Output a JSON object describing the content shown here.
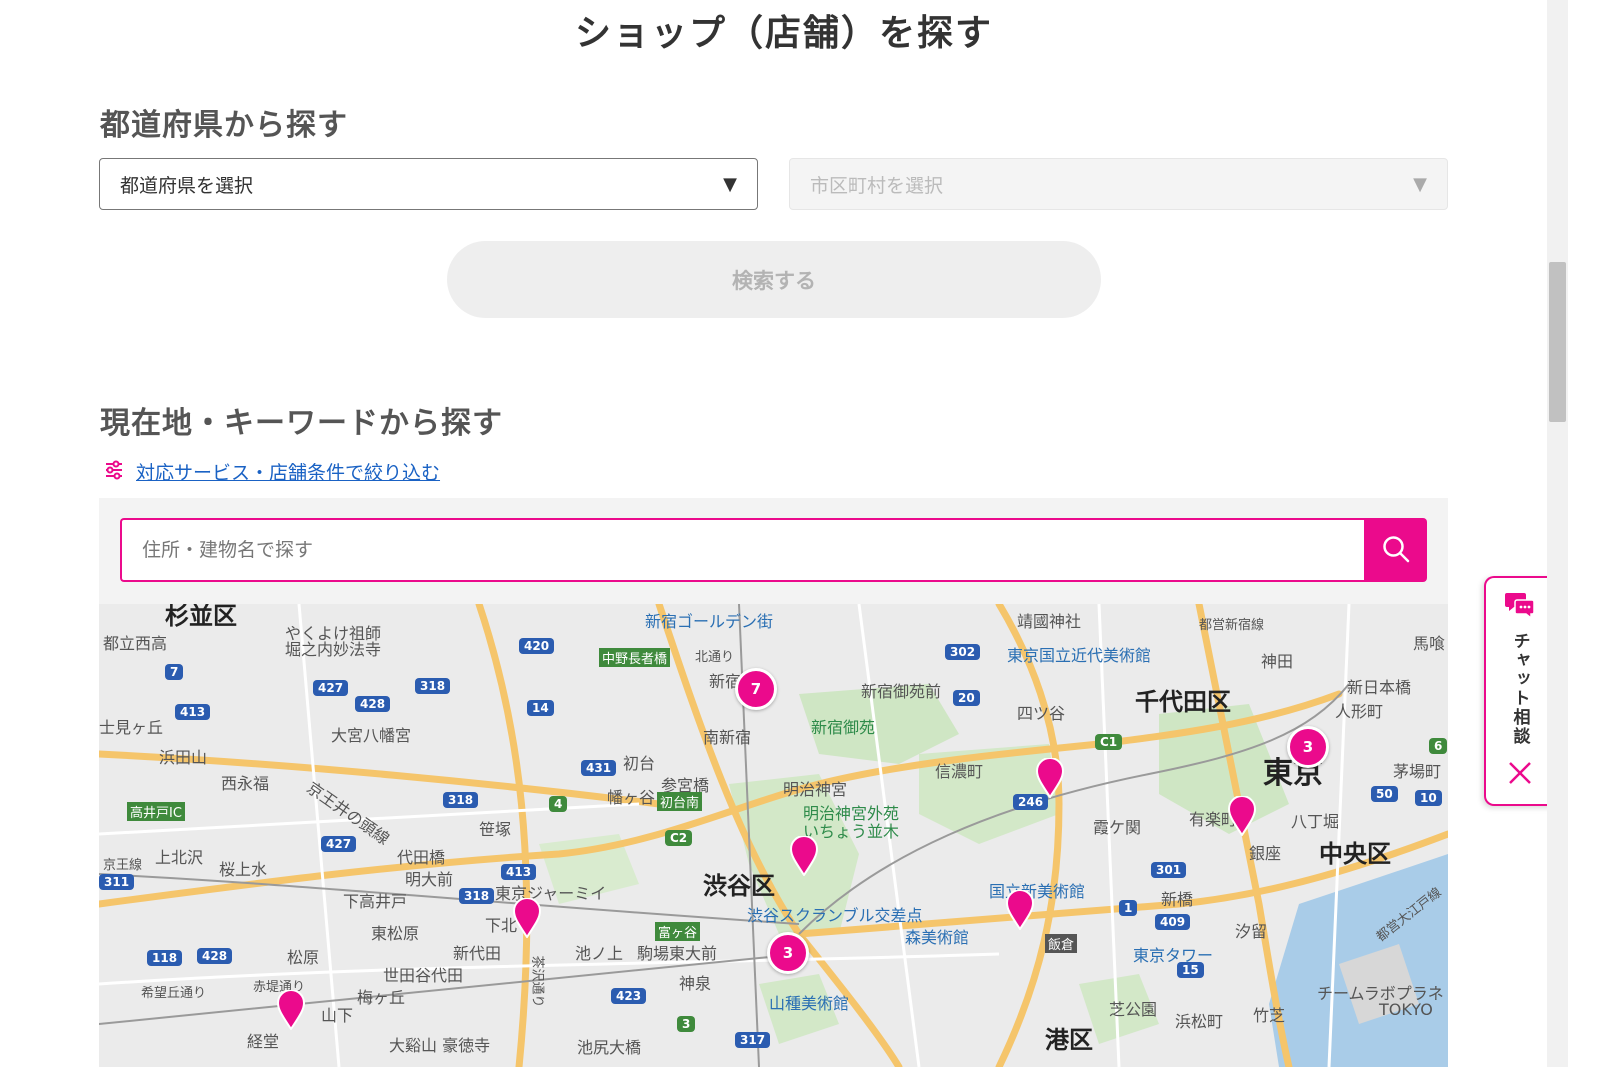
{
  "page_title": "ショップ（店舗）を探す",
  "prefecture_section": {
    "title": "都道府県から探す",
    "prefecture_select": "都道府県を選択",
    "city_select": "市区町村を選択",
    "search_button": "検索する"
  },
  "keyword_section": {
    "title": "現在地・キーワードから探す",
    "filter_link": "対応サービス・店舗条件で絞り込む",
    "search_placeholder": "住所・建物名で探す"
  },
  "map": {
    "labels": {
      "suginami": "杉並区",
      "toritsu_nishi": "都立西高",
      "yakuyoke": "やくよけ祖師",
      "horinouchi": "堀之内妙法寺",
      "golden_gai": "新宿ゴールデン街",
      "yasukuni": "靖國神社",
      "momat": "東京国立近代美術館",
      "toei_shinjuku": "都営新宿線",
      "bakurocho": "馬喰",
      "nakano_choja": "中野長者橋",
      "kitadori": "北通り",
      "shinjuku": "新宿",
      "gyoen_mae": "新宿御苑前",
      "yotsuya": "四ツ谷",
      "chiyoda": "千代田区",
      "kanda": "神田",
      "nihonbashi": "新日本橋",
      "fujimigaoka": "士見ヶ丘",
      "omiya": "大宮八幡宮",
      "minami_shinjuku": "南新宿",
      "gyoen": "新宿御苑",
      "ningyocho": "人形町",
      "hamadayama": "浜田山",
      "nishieifuku": "西永福",
      "hatsudai": "初台",
      "sangubashi": "参宮橋",
      "meiji_jingu": "明治神宮",
      "shinanomachi": "信濃町",
      "tokyo": "東京",
      "kayabacho": "茅場町",
      "takaido_ic": "高井戸IC",
      "keio_inokashira": "京王井の頭線",
      "hatagaya": "幡ヶ谷",
      "hatsudai_minami": "初台南",
      "gaien": "明治神宮外苑",
      "icho": "いちょう並木",
      "yurakucho": "有楽町",
      "hatchobori": "八丁堀",
      "sasazuka": "笹塚",
      "kasumigaseki": "霞ケ関",
      "ginza": "銀座",
      "chuo": "中央区",
      "keio_line": "京王線",
      "kamikitazawa": "上北沢",
      "sakurajosui": "桜上水",
      "yoyogiuehara": "代田橋",
      "meidaimae": "明大前",
      "shibuya": "渋谷区",
      "nact": "国立新美術館",
      "shimotakaido": "下高井戸",
      "tokyo_camii": "東京ジャーミイ",
      "shinbashi": "新橋",
      "shiodome": "汐留",
      "higashimatsubara": "東松原",
      "shimokitazawa": "下北",
      "scramble": "渋谷スクランブル交差点",
      "mori": "森美術館",
      "toei_oedo": "都営大江戸線",
      "matsubara": "松原",
      "shindaita": "新代田",
      "ikenoue": "池ノ上",
      "komaba": "駒場東大前",
      "tomigaya": "富ヶ谷",
      "iikura": "飯倉",
      "tokyo_tower": "東京タワー",
      "setagaya_daita": "世田谷代田",
      "shinsen": "神泉",
      "umegaoka": "梅ヶ丘",
      "kiboogaoka": "希望丘通り",
      "akatsutsumi": "赤堤通り",
      "yamatane": "山種美術館",
      "team_lab": "チームラボプラネ",
      "tokyo_en": "TOKYO",
      "shibakoen": "芝公園",
      "hamamatsucho": "浜松町",
      "takeshiba": "竹芝",
      "yamashita": "山下",
      "kyodo": "経堂",
      "gotokuji": "大谿山 豪徳寺",
      "ikejiri": "池尻大橋",
      "chazawa": "茶沢通り",
      "minato": "港区"
    },
    "routes": [
      "420",
      "302",
      "7",
      "427",
      "428",
      "318",
      "413",
      "14",
      "20",
      "431",
      "4",
      "C1",
      "246",
      "50",
      "10",
      "318",
      "427",
      "C2",
      "311",
      "413",
      "301",
      "318",
      "1",
      "409",
      "118",
      "428",
      "15",
      "423",
      "3",
      "317",
      "6"
    ],
    "clusters": [
      "7",
      "3",
      "3"
    ]
  },
  "chat": {
    "label": "チャット相談"
  }
}
